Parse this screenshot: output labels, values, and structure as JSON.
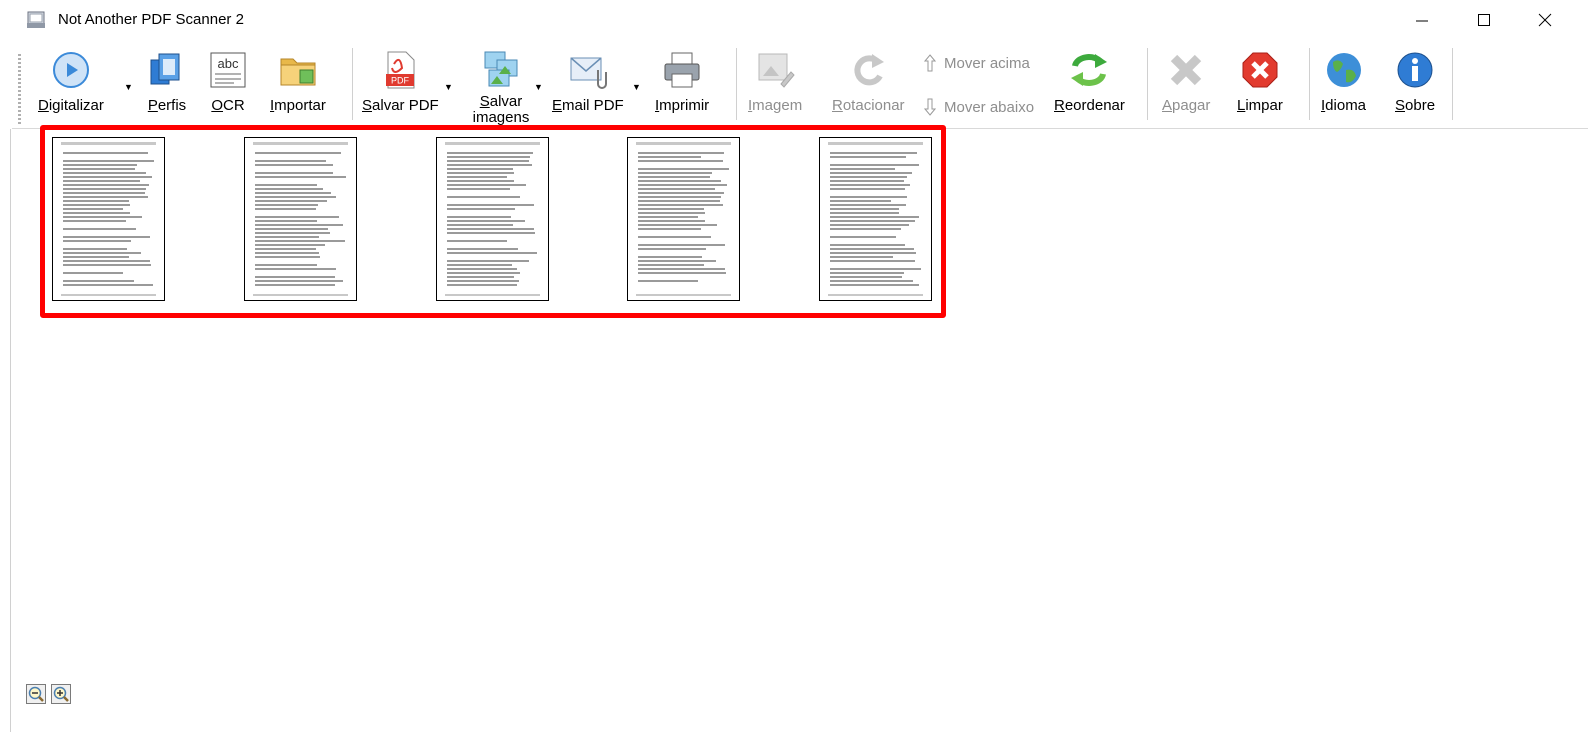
{
  "window": {
    "title": "Not Another PDF Scanner 2",
    "controls": {
      "minimize": "—",
      "maximize": "☐",
      "close": "✕"
    }
  },
  "toolbar": {
    "scan": {
      "label": "Digitalizar",
      "underline": "D",
      "rest": "igitalizar",
      "icon": "scan-play-icon",
      "color": "#3b8ad9"
    },
    "profiles": {
      "label": "Perfis",
      "underline": "P",
      "rest": "erfis",
      "icon": "profiles-icon",
      "color": "#2f7cd4"
    },
    "ocr": {
      "label": "OCR",
      "underline": "O",
      "rest": "CR",
      "icon": "ocr-abc-icon",
      "icon_text": "abc"
    },
    "import": {
      "label": "Importar",
      "underline": "I",
      "rest": "mportar",
      "icon": "folder-image-icon",
      "color": "#e8b84a"
    },
    "save_pdf": {
      "label": "Salvar PDF",
      "underline": "S",
      "rest": "alvar PDF",
      "icon": "pdf-file-icon",
      "icon_text": "PDF",
      "color": "#e03a2f"
    },
    "save_images": {
      "label_line1": "Salvar",
      "label_line2": "imagens",
      "underline": "S",
      "rest": "alvar",
      "icon": "images-icon"
    },
    "email_pdf": {
      "label": "Email PDF",
      "underline": "E",
      "rest": "mail PDF",
      "icon": "email-attachment-icon"
    },
    "print": {
      "label": "Imprimir",
      "underline": "I",
      "rest": "mprimir",
      "icon": "printer-icon"
    },
    "image": {
      "label": "Imagem",
      "underline": "I",
      "rest": "magem",
      "icon": "image-edit-icon",
      "disabled": true
    },
    "rotate": {
      "label": "Rotacionar",
      "underline": "R",
      "rest": "otacionar",
      "icon": "rotate-icon",
      "disabled": true
    },
    "move_up": {
      "label": "Mover acima",
      "icon": "arrow-up-icon",
      "disabled": true
    },
    "move_down": {
      "label": "Mover abaixo",
      "icon": "arrow-down-icon",
      "disabled": true
    },
    "reorder": {
      "label": "Reordenar",
      "underline": "R",
      "rest": "eordenar",
      "icon": "reorder-arrows-icon",
      "color": "#3daa3d"
    },
    "delete": {
      "label": "Apagar",
      "underline": "A",
      "rest": "pagar",
      "icon": "delete-x-icon",
      "disabled": true
    },
    "clear": {
      "label": "Limpar",
      "underline": "L",
      "rest": "impar",
      "icon": "clear-stop-icon",
      "color": "#e23b2f"
    },
    "language": {
      "label": "Idioma",
      "underline": "I",
      "rest": "dioma",
      "icon": "globe-icon"
    },
    "about": {
      "label": "Sobre",
      "underline": "S",
      "rest": "obre",
      "icon": "info-icon",
      "color": "#2f7cd4"
    }
  },
  "pages": [
    {
      "name": "page-1"
    },
    {
      "name": "page-2"
    },
    {
      "name": "page-3"
    },
    {
      "name": "page-4"
    },
    {
      "name": "page-5"
    }
  ],
  "highlight_color": "#ff0000",
  "zoom": {
    "out_icon": "zoom-out-icon",
    "in_icon": "zoom-in-icon"
  }
}
